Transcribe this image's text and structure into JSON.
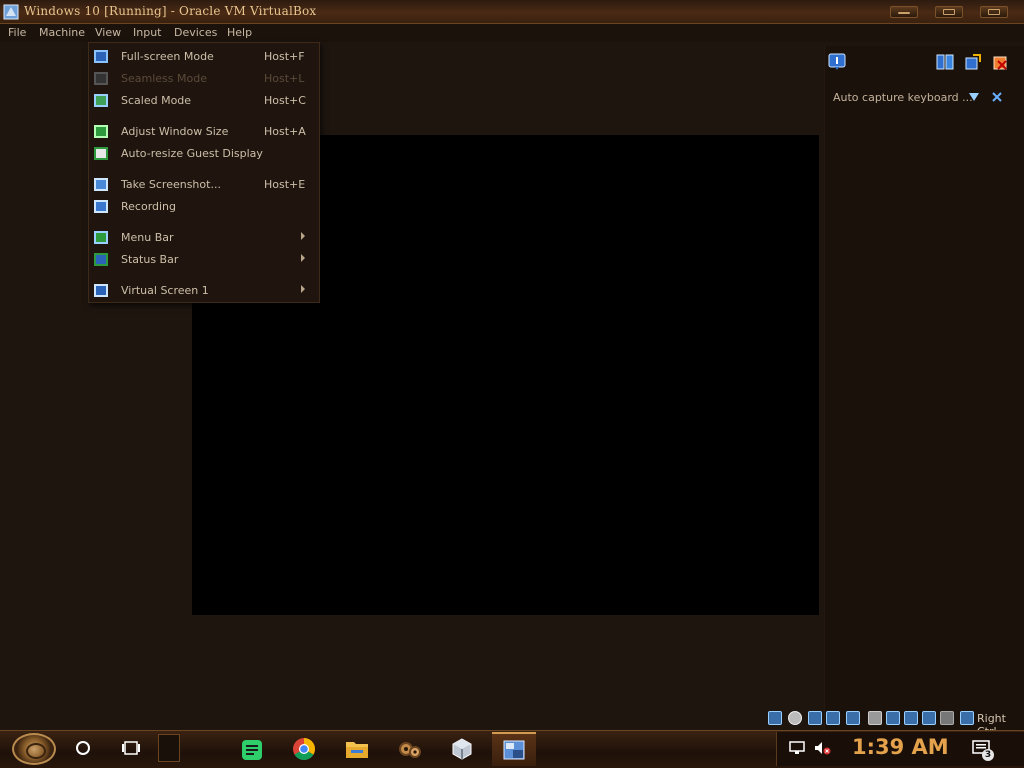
{
  "window": {
    "title": "Windows 10 [Running] - Oracle VM VirtualBox"
  },
  "menubar": {
    "items": [
      "File",
      "Machine",
      "View",
      "Input",
      "Devices",
      "Help"
    ]
  },
  "view_menu": {
    "items": [
      {
        "label": "Full-screen Mode",
        "shortcut": "Host+F",
        "icon": "fullscreen-icon",
        "enabled": true
      },
      {
        "label": "Seamless Mode",
        "shortcut": "Host+L",
        "icon": "seamless-icon",
        "enabled": false
      },
      {
        "label": "Scaled Mode",
        "shortcut": "Host+C",
        "icon": "scaled-icon",
        "enabled": true
      },
      {
        "label": "Adjust Window Size",
        "shortcut": "Host+A",
        "icon": "adjust-window-icon",
        "enabled": true
      },
      {
        "label": "Auto-resize Guest Display",
        "shortcut": "",
        "icon": "auto-resize-icon",
        "enabled": true
      },
      {
        "label": "Take Screenshot...",
        "shortcut": "Host+E",
        "icon": "screenshot-icon",
        "enabled": true
      },
      {
        "label": "Recording",
        "shortcut": "",
        "icon": "recording-icon",
        "enabled": true
      },
      {
        "label": "Menu Bar",
        "shortcut": "",
        "icon": "menu-bar-icon",
        "enabled": true,
        "submenu": true
      },
      {
        "label": "Status Bar",
        "shortcut": "",
        "icon": "status-bar-icon",
        "enabled": true,
        "submenu": true
      },
      {
        "label": "Virtual Screen 1",
        "shortcut": "",
        "icon": "virtual-screen-icon",
        "enabled": true,
        "submenu": true
      }
    ]
  },
  "notification": {
    "text": "Auto capture keyboard ..."
  },
  "statusbar": {
    "host_key": "Right Ctrl"
  },
  "taskbar": {
    "clock": "1:39 AM",
    "notification_count": "3"
  },
  "colors": {
    "accent": "#e3a24b",
    "background": "#1e150f",
    "vm_screen": "#000000"
  }
}
